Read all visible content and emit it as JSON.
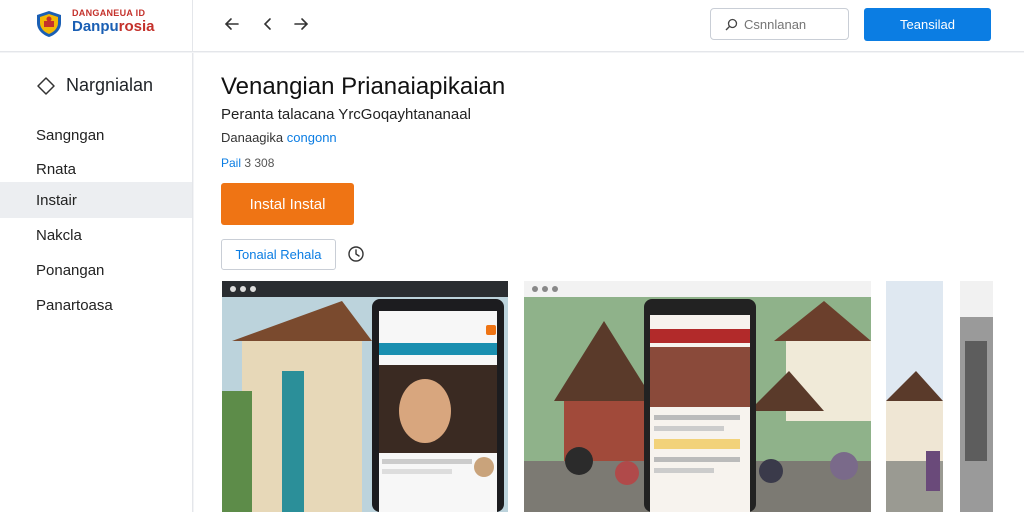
{
  "header": {
    "logo_top": "DANGANEUA ID",
    "logo_main_a": "Danpu",
    "logo_main_b": "rosia",
    "back_icon": "arrow-left-icon",
    "prev_icon": "chevron-left-icon",
    "forward_icon": "arrow-right-icon",
    "search_placeholder": "Csnnlanan",
    "action_label": "Teansilad"
  },
  "sidebar": {
    "heading": "Nargnialan",
    "heading_icon": "diamond-icon",
    "items": [
      {
        "label": "Sangngan"
      },
      {
        "label": "Rnata"
      },
      {
        "label": "Instair"
      },
      {
        "label": "Nakcla"
      },
      {
        "label": "Ponangan"
      },
      {
        "label": "Panartoasa"
      }
    ],
    "active_index": 2
  },
  "main": {
    "title": "Venangian Prianaiapikaian",
    "subtitle": "Peranta talacana YrcGoqayhtananaal",
    "meta_prefix": "Danaagika",
    "meta_link": "congonn",
    "rating_label": "Pail",
    "rating_value": "3 308",
    "install_label": "Instal Instal",
    "secondary_label": "Tonaial Rehala",
    "clock_icon": "clock-icon"
  },
  "colors": {
    "accent_blue": "#0b7de3",
    "install_orange": "#ef7414",
    "sidebar_active": "#eceef1"
  }
}
